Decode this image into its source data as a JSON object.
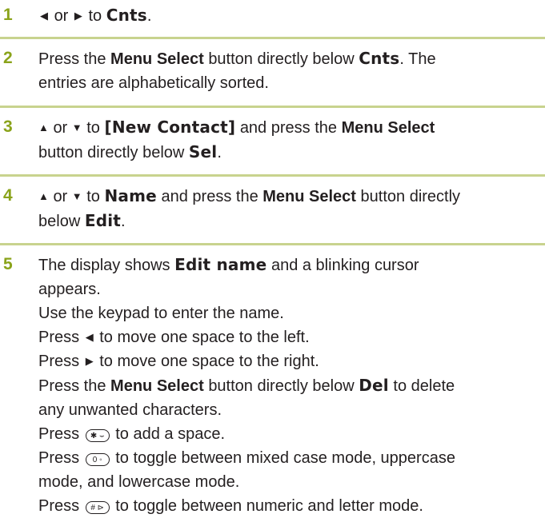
{
  "steps": [
    {
      "num": "1",
      "left_sym": "◀",
      "or": "or",
      "right_sym": "▶",
      "to": "to",
      "target": "Cnts",
      "end": "."
    },
    {
      "num": "2",
      "p1": "Press the",
      "menu_select": "Menu Select",
      "p2": "button directly below",
      "target": "Cnts",
      "p3": ". The",
      "line2": "entries are alphabetically sorted."
    },
    {
      "num": "3",
      "up": "▲",
      "or": "or",
      "down": "▼",
      "to": "to",
      "target": "[New Contact]",
      "p1": "and press the",
      "menu_select": "Menu Select",
      "line2a": "button directly below",
      "target2": "Sel",
      "end": "."
    },
    {
      "num": "4",
      "up": "▲",
      "or": "or",
      "down": "▼",
      "to": "to",
      "target": "Name",
      "p1": "and press the",
      "menu_select": "Menu Select",
      "p2": "button directly",
      "line2a": "below",
      "target2": "Edit",
      "end": "."
    },
    {
      "num": "5",
      "p1": "The display shows",
      "target": "Edit name",
      "p2": "and a blinking cursor",
      "line2": "appears.",
      "l3": "Use the keypad to enter the name.",
      "l4a": "Press",
      "l4sym": "◀",
      "l4b": "to move one space to the left.",
      "l5a": "Press",
      "l5sym": "▶",
      "l5b": "to move one space to the right.",
      "l6a": "Press the",
      "l6ms": "Menu Select",
      "l6b": "button directly below",
      "l6t": "Del",
      "l6c": "to delete",
      "l7": "any unwanted characters.",
      "l8a": "Press",
      "l8key": "✱ ⌣",
      "l8b": "to add a space.",
      "l9a": "Press",
      "l9key": "0 ◦",
      "l9b": "to toggle between mixed case mode, uppercase",
      "l10": "mode, and lowercase mode.",
      "l11a": "Press",
      "l11key": "# ⊳",
      "l11b": "to toggle between numeric and letter mode."
    }
  ]
}
